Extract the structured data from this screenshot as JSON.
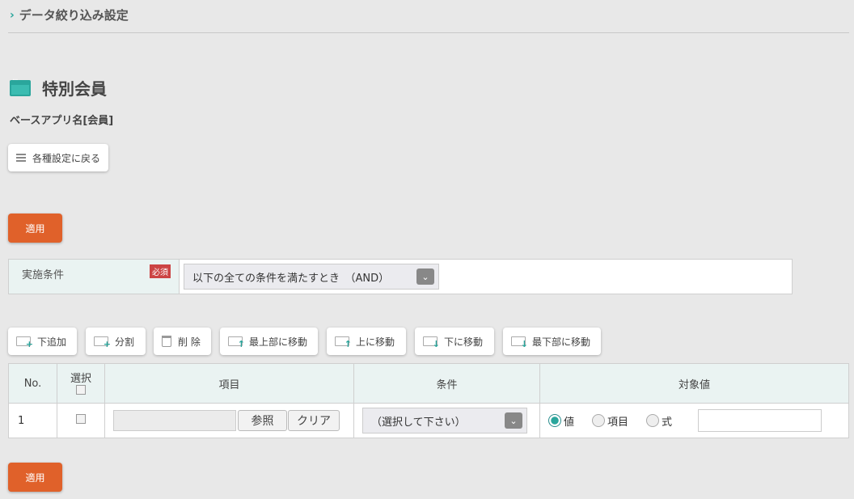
{
  "breadcrumb": {
    "label": "データ絞り込み設定"
  },
  "page": {
    "title": "特別会員",
    "base_app": "ベースアプリ名[会員]"
  },
  "back_button": {
    "label": "各種設定に戻る"
  },
  "apply_label": "適用",
  "condition": {
    "label": "実施条件",
    "required_badge": "必須",
    "selected": "以下の全ての条件を満たすとき　（AND）"
  },
  "toolbar": {
    "add_below": "下追加",
    "split": "分割",
    "delete": "削 除",
    "move_top": "最上部に移動",
    "move_up": "上に移動",
    "move_down": "下に移動",
    "move_bottom": "最下部に移動"
  },
  "table": {
    "headers": {
      "no": "No.",
      "select": "選択",
      "item": "項目",
      "condition": "条件",
      "target": "対象値"
    },
    "rows": [
      {
        "no": "1",
        "browse": "参照",
        "clear": "クリア",
        "condition_placeholder": "（選択して下さい）",
        "radio_value": "値",
        "radio_item": "項目",
        "radio_formula": "式"
      }
    ]
  },
  "colors": {
    "accent": "#2aa69c",
    "apply": "#e0612a",
    "required": "#cc4444"
  }
}
